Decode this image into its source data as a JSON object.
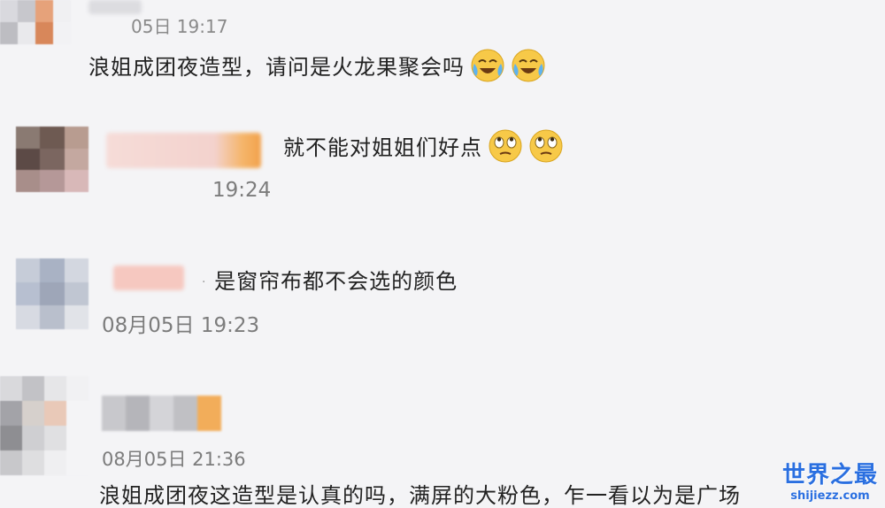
{
  "comments": [
    {
      "timestamp": "05日 19:17",
      "text": "浪姐成团夜造型，请问是火龙果聚会吗",
      "emojis": [
        "crying-laughing-icon",
        "crying-laughing-icon"
      ]
    },
    {
      "timestamp": "19:24",
      "text": "就不能对姐姐们好点",
      "emojis": [
        "eye-roll-icon",
        "eye-roll-icon"
      ]
    },
    {
      "timestamp": "08月05日 19:23",
      "text": "是窗帘布都不会选的颜色"
    },
    {
      "timestamp": "08月05日 21:36",
      "text": "浪姐成团夜这造型是认真的吗，满屏的大粉色，乍一看以为是广场"
    }
  ],
  "watermark": {
    "title": "世界之最",
    "url": "shijiezz.com"
  },
  "colors": {
    "background": "#f4f4f6",
    "text": "#222222",
    "timestamp": "#8a8a8a",
    "watermark": "#2a6fe0"
  }
}
